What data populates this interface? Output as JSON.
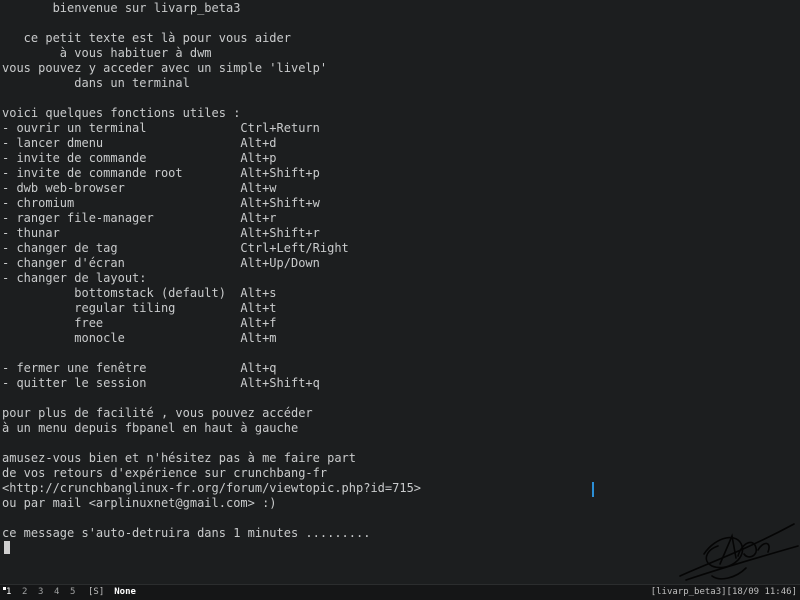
{
  "terminal": {
    "lines": [
      "       bienvenue sur livarp_beta3",
      "",
      "   ce petit texte est là pour vous aider",
      "        à vous habituer à dwm",
      "vous pouvez y acceder avec un simple 'livelp'",
      "          dans un terminal",
      "",
      "voici quelques fonctions utiles :",
      "- ouvrir un terminal             Ctrl+Return",
      "- lancer dmenu                   Alt+d",
      "- invite de commande             Alt+p",
      "- invite de commande root        Alt+Shift+p",
      "- dwb web-browser                Alt+w",
      "- chromium                       Alt+Shift+w",
      "- ranger file-manager            Alt+r",
      "- thunar                         Alt+Shift+r",
      "- changer de tag                 Ctrl+Left/Right",
      "- changer d'écran                Alt+Up/Down",
      "- changer de layout:",
      "          bottomstack (default)  Alt+s",
      "          regular tiling         Alt+t",
      "          free                   Alt+f",
      "          monocle                Alt+m",
      "",
      "- fermer une fenêtre             Alt+q",
      "- quitter le session             Alt+Shift+q",
      "",
      "pour plus de facilité , vous pouvez accéder",
      "à un menu depuis fbpanel en haut à gauche",
      "",
      "amusez-vous bien et n'hésitez pas à me faire part",
      "de vos retours d'expérience sur crunchbang-fr",
      "<http://crunchbanglinux-fr.org/forum/viewtopic.php?id=715>",
      "ou par mail <arplinuxnet@gmail.com> :)",
      "",
      "ce message s'auto-detruira dans 1 minutes ........."
    ]
  },
  "statusbar": {
    "tags": [
      {
        "label": "1",
        "active": true
      },
      {
        "label": "2",
        "active": false
      },
      {
        "label": "3",
        "active": false
      },
      {
        "label": "4",
        "active": false
      },
      {
        "label": "5",
        "active": false
      }
    ],
    "layout_symbol": "[S]",
    "window_title": "None",
    "status_text": "[livarp_beta3][18/09 11:46]"
  },
  "colors": {
    "background": "#1c1e1f",
    "text": "#c9cbcc",
    "cursor": "#cfcfcf",
    "caret": "#2b8fd6"
  },
  "icons": {
    "signature": "signature-logo"
  }
}
